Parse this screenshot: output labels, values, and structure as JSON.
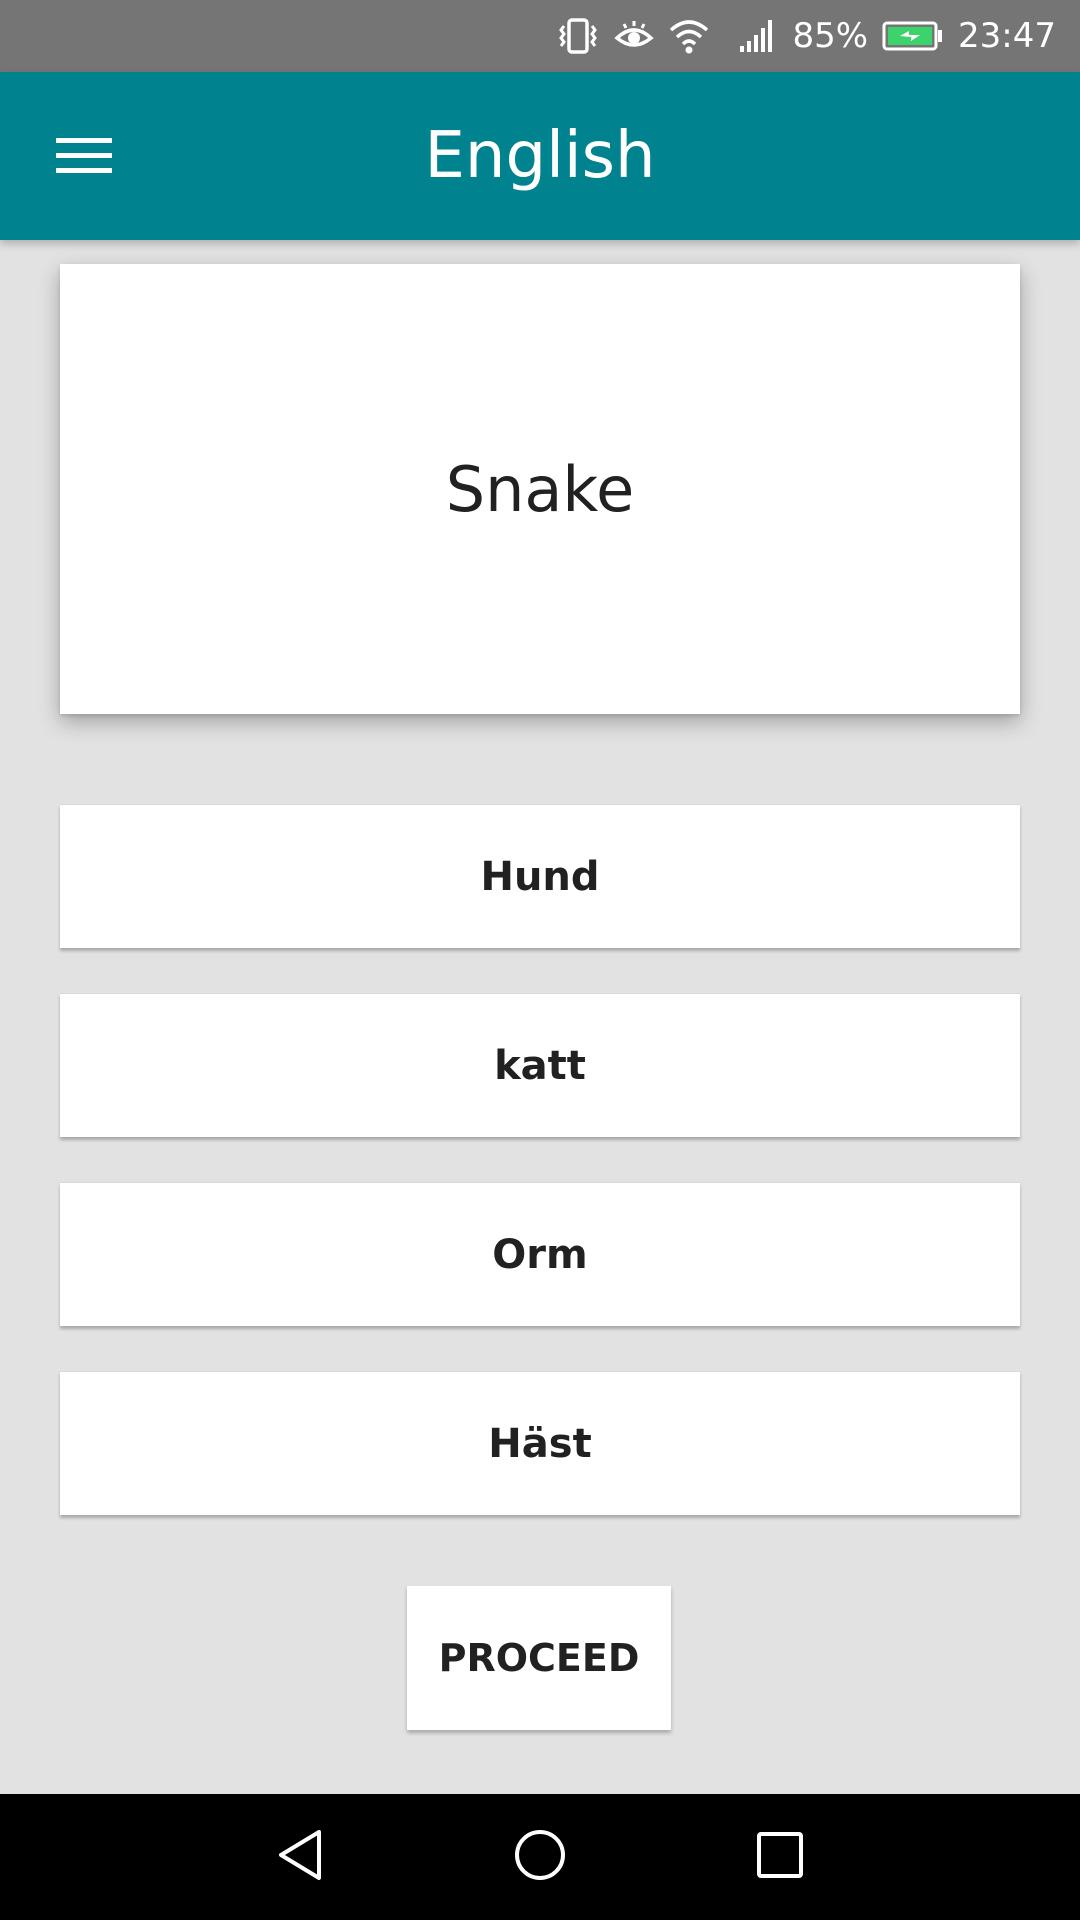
{
  "status_bar": {
    "battery_percent": "85%",
    "time": "23:47",
    "icons": [
      "vibrate-icon",
      "eye-comfort-icon",
      "wifi-icon",
      "signal-icon",
      "battery-charging-icon"
    ]
  },
  "app_bar": {
    "title": "English",
    "menu_icon": "hamburger-menu-icon"
  },
  "quiz": {
    "word": "Snake",
    "options": [
      "Hund",
      "katt",
      "Orm",
      "Häst"
    ],
    "proceed_label": "PROCEED"
  },
  "nav_bar": {
    "icons": [
      "back-icon",
      "home-icon",
      "recents-icon"
    ]
  },
  "colors": {
    "app_bar": "#00838f",
    "status_bar": "#757575",
    "background": "#e2e2e2",
    "battery_fill": "#3dd36b"
  }
}
